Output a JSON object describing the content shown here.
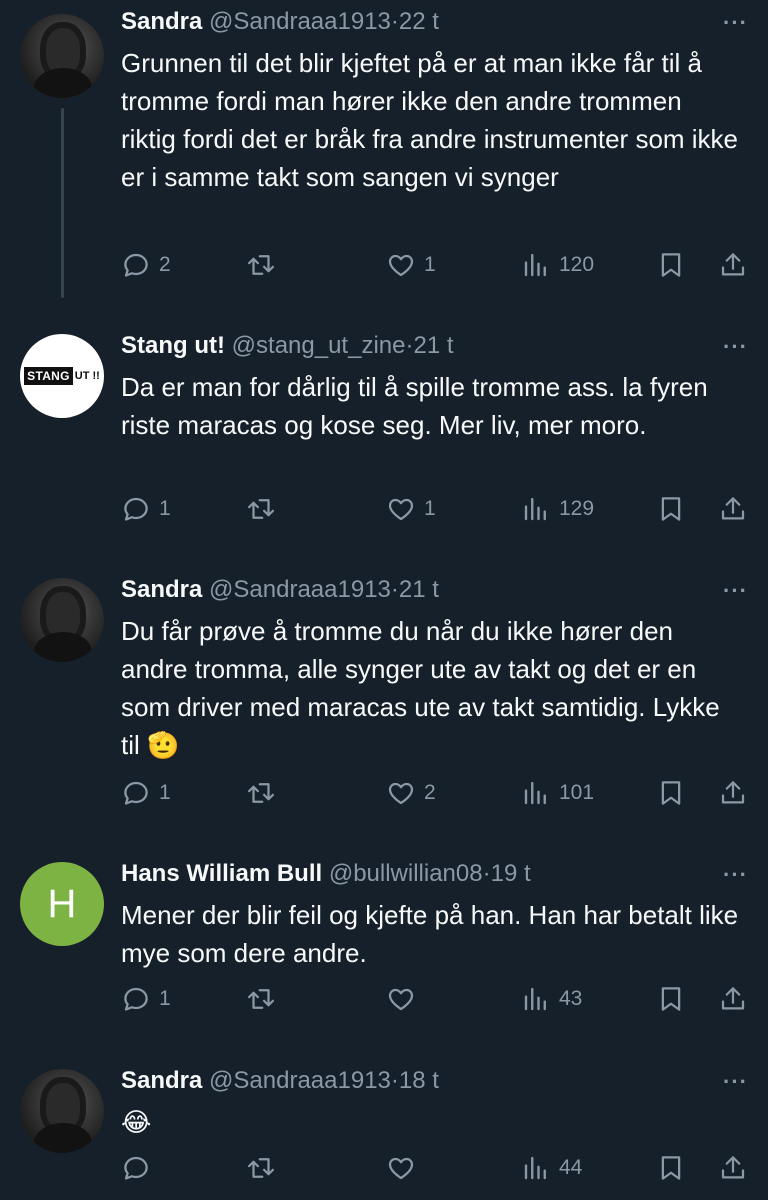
{
  "more_label": "···",
  "tweets": [
    {
      "name": "Sandra",
      "handle": "@Sandraaa1913",
      "time": "22 t",
      "text": "Grunnen til det blir kjeftet på er at man ikke får til å tromme fordi man hører ikke den andre trommen riktig fordi det er bråk fra andre instrumenter som ikke er i samme takt som sangen vi synger",
      "replies": "2",
      "retweets": "",
      "likes": "1",
      "views": "120"
    },
    {
      "name": "Stang ut!",
      "handle": "@stang_ut_zine",
      "time": "21 t",
      "logo_box": "STANG",
      "logo_rest": "UT !!",
      "text": "Da er man for dårlig til å spille tromme ass. la fyren riste maracas og kose seg. Mer liv, mer moro.",
      "replies": "1",
      "retweets": "",
      "likes": "1",
      "views": "129"
    },
    {
      "name": "Sandra",
      "handle": "@Sandraaa1913",
      "time": "21 t",
      "text": "Du får prøve å tromme du når du ikke hører den andre tromma, alle synger ute av takt og det er en som driver med maracas ute av takt samtidig. Lykke til 🫡",
      "replies": "1",
      "retweets": "",
      "likes": "2",
      "views": "101"
    },
    {
      "name": "Hans William Bull",
      "handle": "@bullwillian08",
      "time": "19 t",
      "avatar_letter": "H",
      "text": "Mener der blir feil og kjefte på han. Han har betalt like mye som dere andre.",
      "replies": "1",
      "retweets": "",
      "likes": "",
      "views": "43"
    },
    {
      "name": "Sandra",
      "handle": "@Sandraaa1913",
      "time": "18 t",
      "text": "😂",
      "replies": "",
      "retweets": "",
      "likes": "",
      "views": "44"
    }
  ]
}
